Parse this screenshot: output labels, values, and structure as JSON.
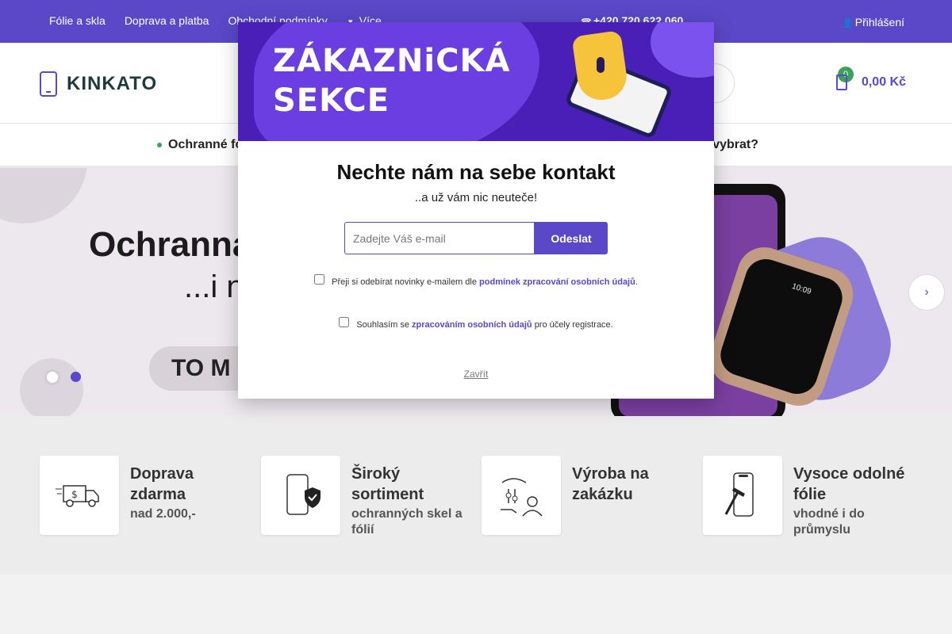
{
  "topbar": {
    "links": [
      "Fólie a skla",
      "Doprava a platba",
      "Obchodní podmínky"
    ],
    "more_label": "Více",
    "phone": "+420 720 622 060",
    "login": "Přihlášení"
  },
  "header": {
    "logo_text": "KINKATO",
    "cart_count": "0",
    "cart_total": "0,00 Kč"
  },
  "nav": {
    "item1": "Ochranné fo",
    "item2": "o vybrat?"
  },
  "hero": {
    "title": "Ochranna",
    "subtitle": "...i n",
    "button": "TO M",
    "watch_time": "10:09",
    "active_slide": 2,
    "slide_count": 2
  },
  "features": [
    {
      "title": "Doprava zdarma",
      "subtitle": "nad 2.000,-",
      "icon": "delivery-truck-icon"
    },
    {
      "title": "Široký sortiment",
      "subtitle": "ochranných skel a fólií",
      "icon": "phone-shield-icon"
    },
    {
      "title": "Výroba na zakázku",
      "subtitle": "",
      "icon": "hand-person-icon"
    },
    {
      "title": "Vysoce odolné fólie",
      "subtitle": "vhodné i do průmyslu",
      "icon": "phone-hammer-icon"
    }
  ],
  "modal": {
    "banner_line1": "ZÁKAZNiCKÁ",
    "banner_line2": "SEKCE",
    "title": "Nechte nám na sebe kontakt",
    "subtitle": "..a už vám nic neuteče!",
    "email_placeholder": "Zadejte Váš e-mail",
    "submit_label": "Odeslat",
    "newsletter_text": "Přeji si odebírat novinky e-mailem dle",
    "newsletter_link": "podmínek zpracování osobních údajů",
    "newsletter_end": ".",
    "consent_text": "Souhlasím se",
    "consent_link": "zpracováním osobních údajů",
    "consent_end": "pro účely registrace.",
    "close_label": "Zavřít"
  },
  "colors": {
    "accent": "#5a48c8",
    "banner": "#4a1fb8",
    "badge": "#3aa35a"
  }
}
